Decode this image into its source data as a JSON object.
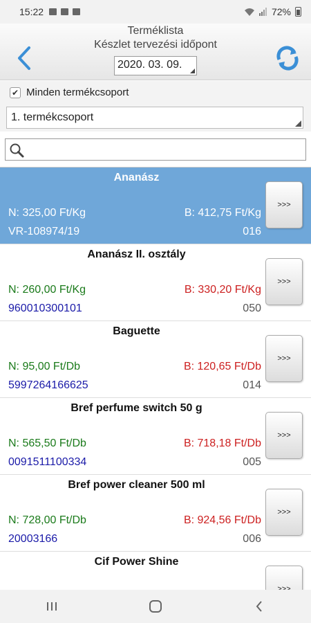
{
  "status_bar": {
    "time": "15:22",
    "battery": "72%"
  },
  "header": {
    "title": "Terméklista",
    "subtitle": "Készlet tervezési időpont",
    "date": "2020. 03. 09."
  },
  "filters": {
    "all_groups_label": "Minden termékcsoport",
    "all_groups_checked": true,
    "group_value": "1. termékcsoport"
  },
  "search": {
    "value": "",
    "placeholder": ""
  },
  "products": [
    {
      "name": "Ananász",
      "net": "N: 325,00 Ft/Kg",
      "gross": "B: 412,75 Ft/Kg",
      "code": "VR-108974/19",
      "num": "016",
      "more": ">>>",
      "selected": true
    },
    {
      "name": "Ananász II. osztály",
      "net": "N: 260,00 Ft/Kg",
      "gross": "B: 330,20 Ft/Kg",
      "code": "960010300101",
      "num": "050",
      "more": ">>>",
      "selected": false
    },
    {
      "name": "Baguette",
      "net": "N: 95,00 Ft/Db",
      "gross": "B: 120,65 Ft/Db",
      "code": "5997264166625",
      "num": "014",
      "more": ">>>",
      "selected": false
    },
    {
      "name": "Bref perfume switch 50 g",
      "net": "N: 565,50 Ft/Db",
      "gross": "B: 718,18 Ft/Db",
      "code": "0091511100334",
      "num": "005",
      "more": ">>>",
      "selected": false
    },
    {
      "name": "Bref power cleaner 500 ml",
      "net": "N: 728,00 Ft/Db",
      "gross": "B: 924,56 Ft/Db",
      "code": "20003166",
      "num": "006",
      "more": ">>>",
      "selected": false
    },
    {
      "name": "Cif Power Shine",
      "net": "",
      "gross": "",
      "code": "",
      "num": "",
      "more": ">>>",
      "selected": false
    }
  ],
  "colors": {
    "accent": "#6fa7d9",
    "net": "#1a7a1a",
    "gross": "#cc1f1f",
    "code": "#1a1aa8",
    "icon_blue": "#3b8fd6"
  },
  "icons": {
    "back": "back-arrow-icon",
    "refresh": "refresh-icon",
    "search": "search-icon"
  }
}
